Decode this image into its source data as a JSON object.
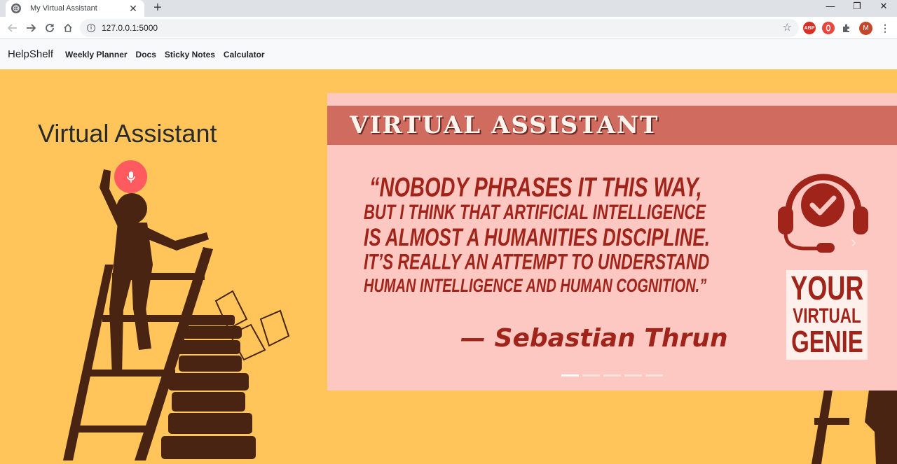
{
  "browser": {
    "tab_title": "My Virtual Assistant",
    "tab_close": "✕",
    "new_tab": "+",
    "url": "127.0.0.1:5000",
    "profile_initial": "M",
    "abp_label": "ABP",
    "window_controls": {
      "minimize": "—",
      "restore": "❐",
      "close": "✕"
    }
  },
  "navbar": {
    "brand": "HelpShelf",
    "links": [
      "Weekly Planner",
      "Docs",
      "Sticky Notes",
      "Calculator"
    ]
  },
  "main": {
    "heading": "Virtual Assistant"
  },
  "carousel": {
    "banner": "VIRTUAL ASSISTANT",
    "quote_lines": [
      "“NOBODY PHRASES IT THIS WAY,",
      "BUT I THINK THAT ARTIFICIAL INTELLIGENCE",
      "IS ALMOST A HUMANITIES DISCIPLINE.",
      "IT’S REALLY AN ATTEMPT TO UNDERSTAND",
      "HUMAN INTELLIGENCE AND HUMAN COGNITION.”"
    ],
    "author": "— Sebastian Thrun",
    "genie_lines": [
      "YOUR",
      "VIRTUAL",
      "GENIE"
    ],
    "prev": "‹",
    "next": "›",
    "slide_count": 5,
    "active_slide": 1
  },
  "colors": {
    "page_background": "#ffc55a",
    "mic_button": "#ff5a5f",
    "banner": "#cf6b5f",
    "quote_text": "#a1241b",
    "silhouette": "#4a2413"
  }
}
